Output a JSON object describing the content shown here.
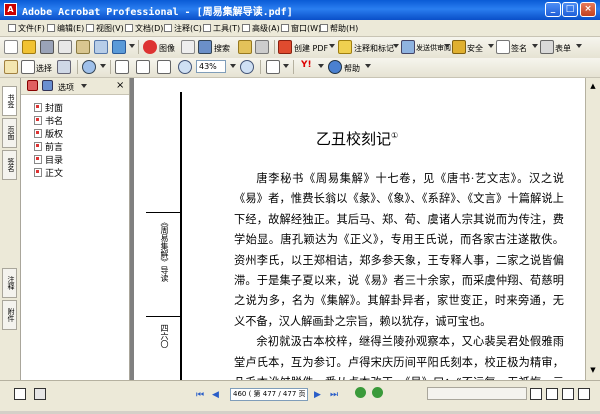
{
  "window": {
    "title": "Adobe Acrobat Professional - [周易集解导读.pdf]",
    "app_icon": "acrobat-icon"
  },
  "menu": [
    {
      "label": "文件(F)"
    },
    {
      "label": "编辑(E)"
    },
    {
      "label": "视图(V)"
    },
    {
      "label": "文档(D)"
    },
    {
      "label": "注释(C)"
    },
    {
      "label": "工具(T)"
    },
    {
      "label": "高级(A)"
    },
    {
      "label": "窗口(W)"
    },
    {
      "label": "帮助(H)"
    }
  ],
  "toolbar1": {
    "print_label": "图像",
    "search_label": "搜索",
    "create_pdf_label": "创建 PDF",
    "comment_label": "注释和标记",
    "send_review_label": "发送供审阅",
    "secure_label": "安全",
    "sign_label": "签名",
    "forms_label": "表单"
  },
  "toolbar2": {
    "select_label": "选择",
    "zoom_value": "43%",
    "help_label": "帮助"
  },
  "left_tabs": [
    "书签",
    "页面",
    "签名",
    "注释",
    "附件"
  ],
  "bookmarks": {
    "options_label": "选项",
    "items": [
      {
        "label": "封面"
      },
      {
        "label": "书名"
      },
      {
        "label": "版权"
      },
      {
        "label": "前言"
      },
      {
        "label": "目录"
      },
      {
        "label": "正文"
      }
    ]
  },
  "document": {
    "margin_title": "《周易集解》导读",
    "margin_page": "四六〇",
    "heading": "乙丑校刻记",
    "footnote_mark": "①",
    "paragraphs": [
      "唐李秘书《周易集解》十七卷，见《唐书·艺文志》。汉之说《易》者，惟费长翁以《彖》、《象》、《系辞》、《文言》十篇解说上下经，故解经独正。其后马、郑、荀、虞诸人宗其说而为传注，费学始显。唐孔颖达为《正义》，专用王氏说，而各家古注遂散佚。资州李氏，以王郑相诘，郑多参天象，王专释人事，二家之说皆偏滞。于是集子夏以来，说《易》者三十余家，而采虞仲翔、荀慈明之说为多，名为《集解》。其解卦异者，家世变正，时来旁通，无义不备，汉人解画卦之宗旨，赖以犹存，诚可宝也。",
      "余初就汲古本校梓，继得兰陵孙观察本，又心裴吴君处假雅雨堂卢氏本，互为参订。卢得宋庆历间平阳氏刻本，校正极为精审，凡毛本讹舛脱佚，悉从卢本改正。《易》曰：“不远复，无祇悔，元吉。”与十五卷颜氏之子为一节，毛本误分刻十六卷之首，今从"
    ]
  },
  "status": {
    "page_display": "460 ( 第 477 / 477 页 )"
  }
}
